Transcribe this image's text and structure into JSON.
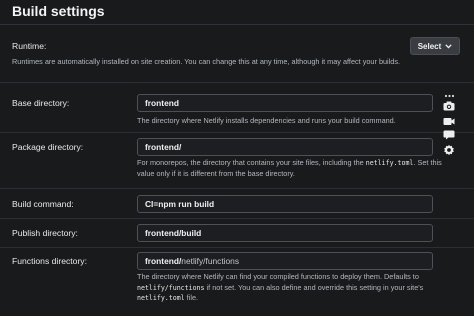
{
  "header": {
    "title": "Build settings"
  },
  "runtime": {
    "label": "Runtime:",
    "help": "Runtimes are automatically installed on site creation. You can change this at any time, although it may affect your builds.",
    "select_label": "Select"
  },
  "base_directory": {
    "label": "Base directory:",
    "value": "frontend",
    "help": "The directory where Netlify installs dependencies and runs your build command."
  },
  "package_directory": {
    "label": "Package directory:",
    "value": "frontend/",
    "help_1": "For monorepos, the directory that contains your site files, including the",
    "help_code": "netlify.toml",
    "help_2": ". Set this value only if it is different from the base directory."
  },
  "build_command": {
    "label": "Build command:",
    "value": "CI=npm run build"
  },
  "publish_directory": {
    "label": "Publish directory:",
    "value": "frontend/build"
  },
  "functions_directory": {
    "label": "Functions directory:",
    "value_prefix": "frontend/",
    "value_suffix": "netlify/functions",
    "help_1": "The directory where Netlify can find your compiled functions to deploy them. Defaults to",
    "help_code_1": "netlify/functions",
    "help_2": "if not set. You can also define and override this setting in your site's",
    "help_code_2": "netlify.toml",
    "help_3": "file."
  },
  "toolbar_icons": [
    "more-icon",
    "camera-icon",
    "video-camera-icon",
    "chat-icon",
    "gear-icon"
  ]
}
